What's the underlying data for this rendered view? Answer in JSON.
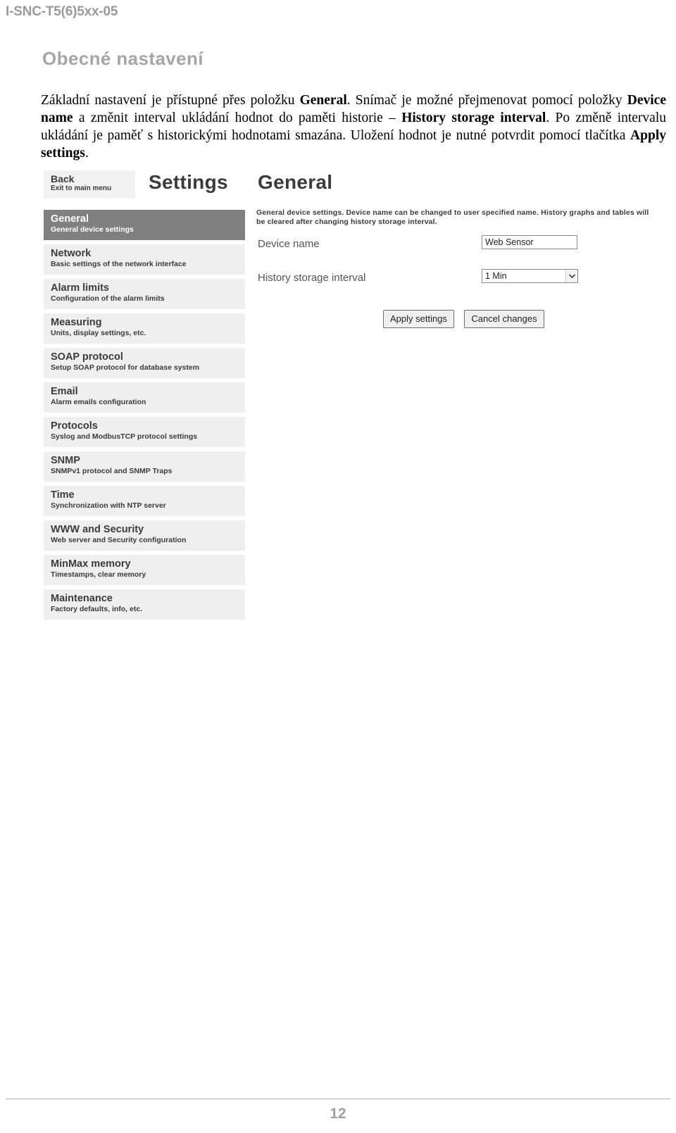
{
  "document": {
    "header_code": "I-SNC-T5(6)5xx-05",
    "page_number": "12",
    "section_heading": "Obecné nastavení",
    "paragraph": {
      "t1": "Základní nastavení je přístupné přes položku ",
      "b1": "General",
      "t2": ". Snímač je možné přejmenovat pomocí položky ",
      "b2": "Device name",
      "t3": " a změnit interval ukládání hodnot do paměti historie – ",
      "b3": "History storage interval",
      "t4": ". Po změně intervalu ukládání je paměť s historickými hodnotami smazána. Uložení hodnot je nutné potvrdit pomocí tlačítka ",
      "b4": "Apply settings",
      "t5": "."
    }
  },
  "app": {
    "back_button": {
      "title": "Back",
      "subtitle": "Exit to main menu"
    },
    "title_primary": "Settings",
    "title_secondary": "General",
    "sidebar": {
      "items": [
        {
          "title": "General",
          "subtitle": "General device settings",
          "active": true
        },
        {
          "title": "Network",
          "subtitle": "Basic settings of the network interface",
          "active": false
        },
        {
          "title": "Alarm limits",
          "subtitle": "Configuration of the alarm limits",
          "active": false
        },
        {
          "title": "Measuring",
          "subtitle": "Units, display settings, etc.",
          "active": false
        },
        {
          "title": "SOAP protocol",
          "subtitle": "Setup SOAP protocol for database system",
          "active": false
        },
        {
          "title": "Email",
          "subtitle": "Alarm emails configuration",
          "active": false
        },
        {
          "title": "Protocols",
          "subtitle": "Syslog and ModbusTCP protocol settings",
          "active": false
        },
        {
          "title": "SNMP",
          "subtitle": "SNMPv1 protocol and SNMP Traps",
          "active": false
        },
        {
          "title": "Time",
          "subtitle": "Synchronization with NTP server",
          "active": false
        },
        {
          "title": "WWW and Security",
          "subtitle": "Web server and Security configuration",
          "active": false
        },
        {
          "title": "MinMax memory",
          "subtitle": "Timestamps, clear memory",
          "active": false
        },
        {
          "title": "Maintenance",
          "subtitle": "Factory defaults, info, etc.",
          "active": false
        }
      ]
    },
    "content": {
      "description": "General device settings. Device name can be changed to user specified name. History graphs and tables will be cleared after changing history storage interval.",
      "fields": {
        "device_name_label": "Device name",
        "device_name_value": "Web Sensor",
        "history_interval_label": "History storage interval",
        "history_interval_value": "1 Min"
      },
      "buttons": {
        "apply": "Apply settings",
        "cancel": "Cancel changes"
      }
    },
    "colors": {
      "active_item_bg": "#808080",
      "item_bg": "#efefef",
      "text": "#3b3b3b"
    }
  }
}
